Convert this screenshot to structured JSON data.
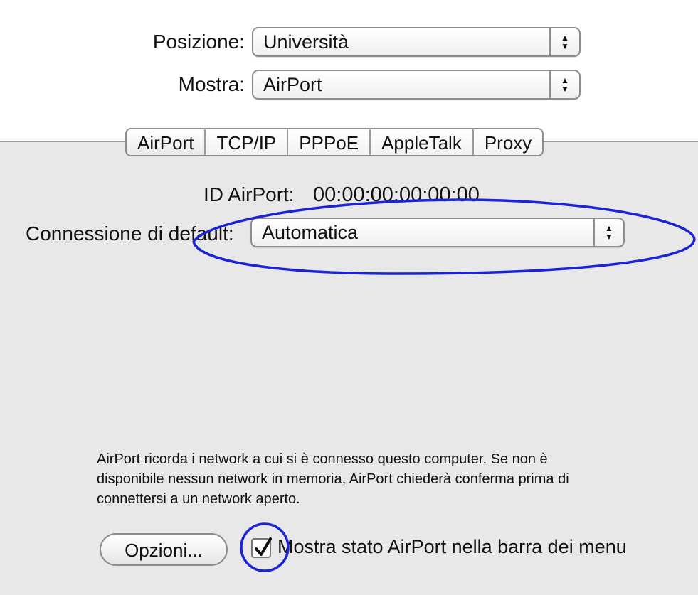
{
  "location": {
    "label": "Posizione:",
    "value": "Università"
  },
  "show": {
    "label": "Mostra:",
    "value": "AirPort"
  },
  "tabs": [
    {
      "label": "AirPort",
      "active": true
    },
    {
      "label": "TCP/IP",
      "active": false
    },
    {
      "label": "PPPoE",
      "active": false
    },
    {
      "label": "AppleTalk",
      "active": false
    },
    {
      "label": "Proxy",
      "active": false
    }
  ],
  "airport_id": {
    "label": "ID AirPort:",
    "value": "00:00:00:00:00:00"
  },
  "default_connection": {
    "label": "Connessione di default:",
    "value": "Automatica"
  },
  "description": "AirPort ricorda i network a cui si è connesso questo computer. Se non è disponibile nessun network in memoria, AirPort chiederà conferma prima di connettersi a un network aperto.",
  "options_button": "Opzioni...",
  "menu_status_checkbox": {
    "label": "Mostra stato AirPort nella barra dei menu",
    "checked": true
  },
  "colors": {
    "annotation": "#1a24d6",
    "panel": "#e8e8e8"
  },
  "icons": {
    "popup_arrows": "updown-arrows-icon",
    "check": "checkmark-icon"
  }
}
